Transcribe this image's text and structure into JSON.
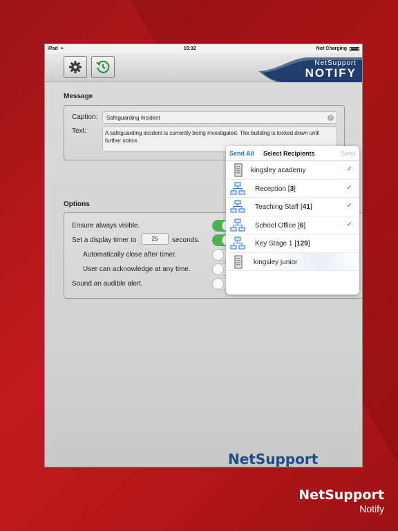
{
  "status_bar": {
    "device": "iPad",
    "time": "15:32",
    "battery_text": "Not Charging"
  },
  "toolbar": {
    "settings_icon": "gear-icon",
    "history_icon": "history-icon",
    "brand_top": "NetSupport",
    "brand_bottom": "NOTIFY"
  },
  "message": {
    "section_label": "Message",
    "caption_label": "Caption:",
    "caption_value": "Safeguarding Incident",
    "text_label": "Text:",
    "text_value": "A safeguarding incident is currently being investigated. The building is locked down until further notice."
  },
  "options": {
    "section_label": "Options",
    "always_visible": "Ensure always visible.",
    "timer_prefix": "Set a display timer to",
    "timer_value": "25",
    "timer_suffix": "seconds.",
    "auto_close": "Automatically close after timer.",
    "acknowledge": "User can acknowledge at any time.",
    "audible": "Sound an audible alert.",
    "toggles": {
      "always_visible": true,
      "display_timer": true,
      "auto_close": false,
      "acknowledge": false,
      "audible": false
    }
  },
  "recipients_popover": {
    "send_all": "Send All",
    "title": "Select Recipients",
    "send": "Send",
    "items": [
      {
        "name": "kingsley academy",
        "count": "",
        "icon": "server-icon",
        "checked": true
      },
      {
        "name": "Reception",
        "count": "3",
        "icon": "network-group-icon",
        "checked": true
      },
      {
        "name": "Teaching Staff",
        "count": "41",
        "icon": "network-group-icon",
        "checked": true
      },
      {
        "name": "School Office",
        "count": "6",
        "icon": "network-group-icon",
        "checked": true
      },
      {
        "name": "Key Stage 1",
        "count": "129",
        "icon": "network-group-icon",
        "checked": false
      },
      {
        "name": "kingsley junior",
        "count": "",
        "icon": "server-icon",
        "checked": false
      }
    ]
  },
  "footer_logo": "NetSupport",
  "corner_brand": {
    "name": "NetSupport",
    "product": "Notify"
  },
  "colors": {
    "accent_blue": "#2c6fd0",
    "toggle_on": "#4cb250",
    "background_red": "#c0191d",
    "brand_navy": "#1f4c86"
  }
}
